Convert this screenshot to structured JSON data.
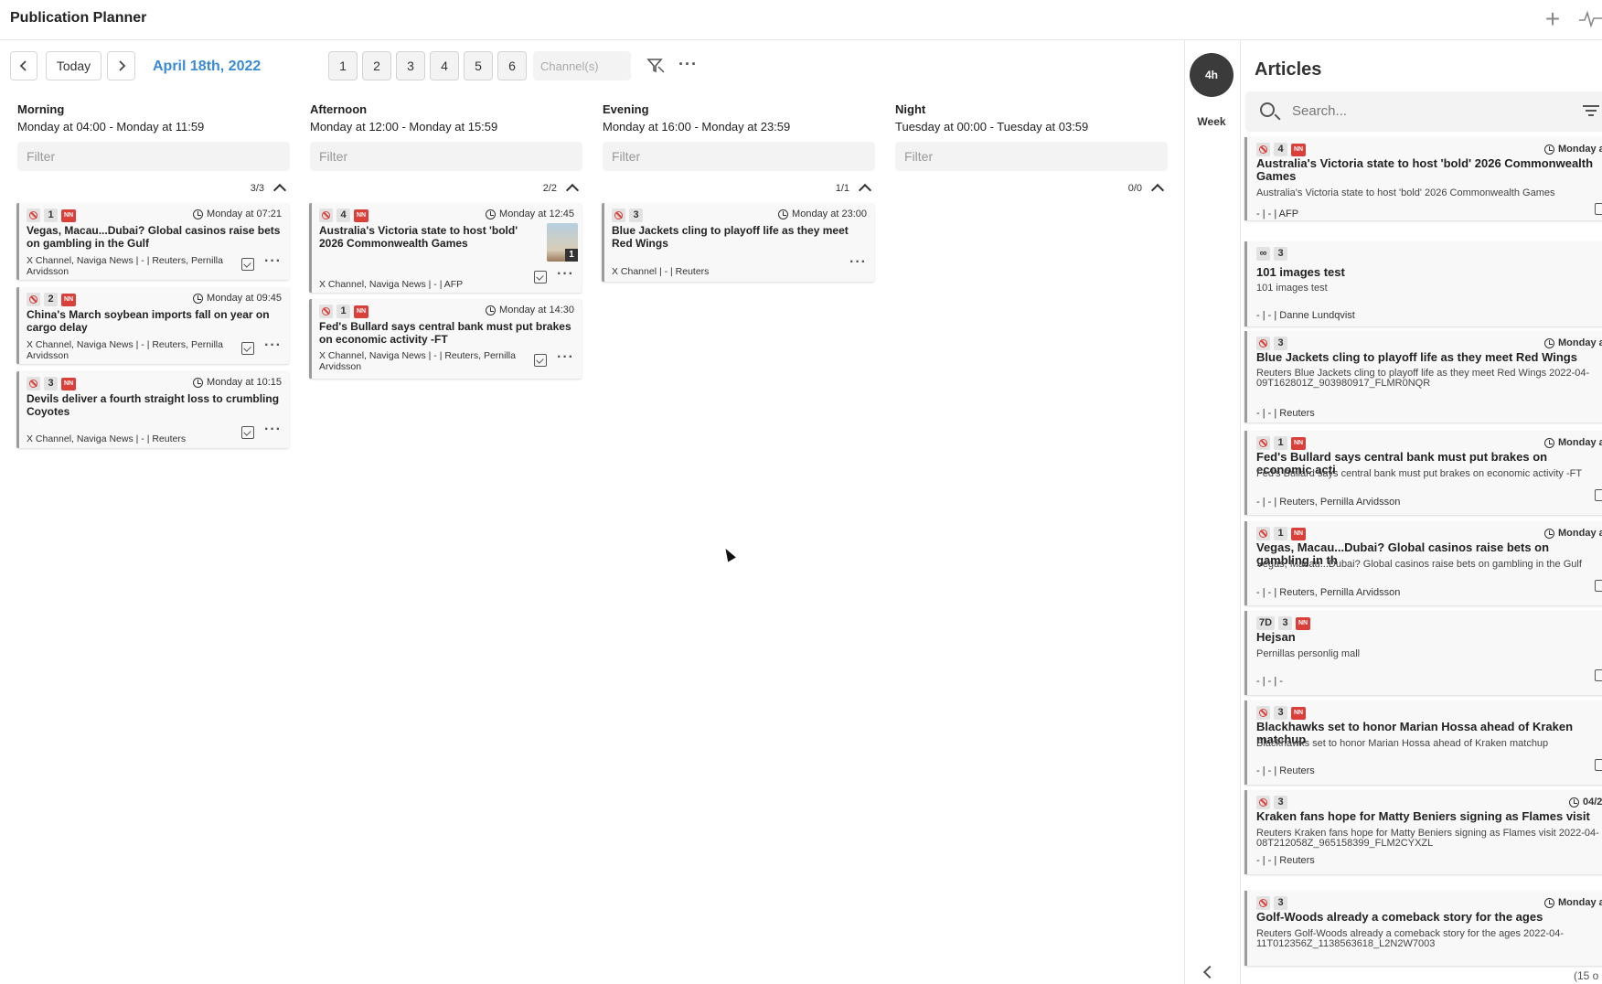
{
  "app": {
    "title": "Publication Planner"
  },
  "toolbar": {
    "prev_icon": "chevron-left-icon",
    "today_label": "Today",
    "next_icon": "chevron-right-icon",
    "date": "April 18th, 2022",
    "pages": [
      "1",
      "2",
      "3",
      "4",
      "5",
      "6"
    ],
    "channel_placeholder": "Channel(s)"
  },
  "columns": [
    {
      "name": "Morning",
      "range": "Monday at 04:00 - Monday at 11:59",
      "filter": "Filter",
      "count": "3/3",
      "cards": [
        {
          "num": "1",
          "nn": "NN",
          "time": "Monday at 07:21",
          "title": "Vegas, Macau...Dubai? Global casinos raise bets on gambling in the Gulf",
          "meta": "X Channel, Naviga News | - | Reuters, Pernilla Arvidsson"
        },
        {
          "num": "2",
          "nn": "NN",
          "time": "Monday at 09:45",
          "title": "China's March soybean imports fall on year on cargo delay",
          "meta": "X Channel, Naviga News | - | Reuters, Pernilla Arvidsson"
        },
        {
          "num": "3",
          "nn": "NN",
          "time": "Monday at 10:15",
          "title": "Devils deliver a fourth straight loss to crumbling Coyotes",
          "meta": "X Channel, Naviga News | - | Reuters"
        }
      ]
    },
    {
      "name": "Afternoon",
      "range": "Monday at 12:00 - Monday at 15:59",
      "filter": "Filter",
      "count": "2/2",
      "cards": [
        {
          "num": "4",
          "nn": "NN",
          "time": "Monday at 12:45",
          "title": "Australia's Victoria state to host 'bold' 2026 Commonwealth Games",
          "meta": "X Channel, Naviga News | - | AFP",
          "thumb_count": "1"
        },
        {
          "num": "1",
          "nn": "NN",
          "time": "Monday at 14:30",
          "title": "Fed's Bullard says central bank must put brakes on economic activity -FT",
          "meta": "X Channel, Naviga News | - | Reuters, Pernilla Arvidsson"
        }
      ]
    },
    {
      "name": "Evening",
      "range": "Monday at 16:00 - Monday at 23:59",
      "filter": "Filter",
      "count": "1/1",
      "cards": [
        {
          "num": "3",
          "time": "Monday at 23:00",
          "title": "Blue Jackets cling to playoff life as they meet Red Wings",
          "meta": "X Channel | - | Reuters"
        }
      ]
    },
    {
      "name": "Night",
      "range": "Tuesday at 00:00 - Tuesday at 03:59",
      "filter": "Filter",
      "count": "0/0",
      "cards": []
    }
  ],
  "side": {
    "zoom": "4h",
    "week": "Week"
  },
  "articles": {
    "heading": "Articles",
    "search_placeholder": "Search...",
    "footer": "(15 o",
    "items": [
      {
        "badge": "",
        "num": "4",
        "nn": "NN",
        "time": "Monday a",
        "title": "Australia's Victoria state to host 'bold' 2026 Commonwealth Games",
        "desc": "Australia's Victoria state to host 'bold' 2026 Commonwealth Games",
        "meta": "- | - | AFP"
      },
      {
        "badge": "∞",
        "num": "3",
        "nn": "",
        "time": "",
        "title": "101 images test",
        "desc": "101 images test",
        "meta": "- | - | Danne Lundqvist"
      },
      {
        "badge": "",
        "num": "3",
        "nn": "",
        "time": "Monday a",
        "title": "Blue Jackets cling to playoff life as they meet Red Wings",
        "desc": "Reuters Blue Jackets cling to playoff life as they meet Red Wings 2022-04-09T162801Z_903980917_FLMR0NQR",
        "meta": "- | - | Reuters"
      },
      {
        "badge": "",
        "num": "1",
        "nn": "NN",
        "time": "Monday a",
        "title": "Fed's Bullard says central bank must put brakes on economic acti",
        "desc": "Fed's Bullard says central bank must put brakes on economic activity -FT",
        "meta": "- | - | Reuters, Pernilla Arvidsson"
      },
      {
        "badge": "",
        "num": "1",
        "nn": "NN",
        "time": "Monday a",
        "title": "Vegas, Macau...Dubai? Global casinos raise bets on gambling in th",
        "desc": "Vegas, Macau...Dubai? Global casinos raise bets on gambling in the Gulf",
        "meta": "- | - | Reuters, Pernilla Arvidsson"
      },
      {
        "badge": "7D",
        "num": "3",
        "nn": "NN",
        "time": "",
        "title": "Hejsan",
        "desc": "Pernillas personlig mall",
        "meta": "- | - | -"
      },
      {
        "badge": "",
        "num": "3",
        "nn": "NN",
        "time": "",
        "title": "Blackhawks set to honor Marian Hossa ahead of Kraken matchup",
        "desc": "Blackhawks set to honor Marian Hossa ahead of Kraken matchup",
        "meta": "- | - | Reuters"
      },
      {
        "badge": "",
        "num": "3",
        "nn": "",
        "time": "04/2",
        "title": "Kraken fans hope for Matty Beniers signing as Flames visit",
        "desc": "Reuters Kraken fans hope for Matty Beniers signing as Flames visit 2022-04-08T212058Z_965158399_FLM2CYXZL",
        "meta": "- | - | Reuters"
      },
      {
        "badge": "",
        "num": "3",
        "nn": "",
        "time": "Monday a",
        "title": "Golf-Woods already a comeback story for the ages",
        "desc": "Reuters Golf-Woods already a comeback story for the ages 2022-04-11T012356Z_1138563618_L2N2W7003",
        "meta": ""
      }
    ]
  }
}
